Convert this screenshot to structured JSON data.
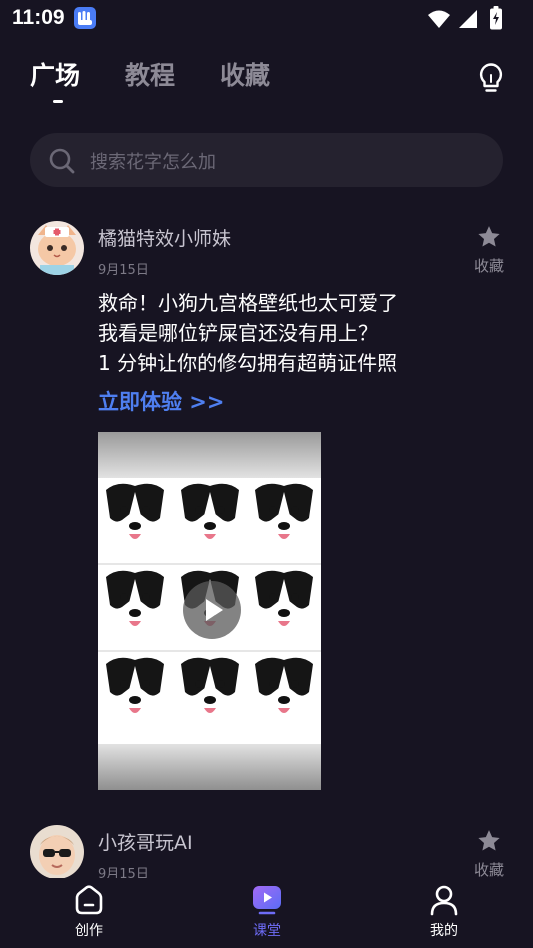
{
  "status_bar": {
    "time": "11:09",
    "app_icon": "app-notification-icon",
    "icons": [
      "wifi-icon",
      "cellular-signal-icon",
      "battery-charging-icon"
    ]
  },
  "top_tabs": {
    "items": [
      {
        "label": "广场",
        "active": true
      },
      {
        "label": "教程",
        "active": false
      },
      {
        "label": "收藏",
        "active": false
      }
    ],
    "action_icon": "lightbulb-icon"
  },
  "search": {
    "placeholder": "搜索花字怎么加",
    "icon": "search-icon"
  },
  "posts": [
    {
      "author": "橘猫特效小师妹",
      "date": "9月15日",
      "favorite_label": "收藏",
      "text_lines": [
        "救命！小狗九宫格壁纸也太可爱了",
        "我看是哪位铲屎官还没有用上？",
        "1 分钟让你的修勾拥有超萌证件照"
      ],
      "link": "立即体验 >>",
      "media": {
        "type": "video",
        "icon": "play-icon"
      }
    },
    {
      "author": "小孩哥玩AI",
      "date": "9月15日",
      "favorite_label": "收藏"
    }
  ],
  "bottom_nav": {
    "items": [
      {
        "label": "创作",
        "icon": "home-icon",
        "active": false
      },
      {
        "label": "课堂",
        "icon": "video-play-icon",
        "active": true
      },
      {
        "label": "我的",
        "icon": "profile-icon",
        "active": false
      }
    ]
  },
  "colors": {
    "background": "#171422",
    "search_bg": "#25222f",
    "accent_link": "#4f7ff0",
    "nav_active": "#6e6cf7",
    "muted_text": "#8d8a96"
  }
}
